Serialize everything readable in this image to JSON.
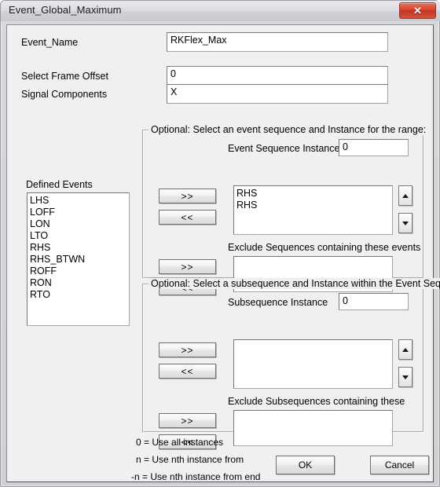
{
  "window": {
    "title": "Event_Global_Maximum",
    "close_label": "✕",
    "close_icon": "close-icon"
  },
  "form": {
    "event_name": {
      "label": "Event_Name",
      "value": "RKFlex_Max",
      "placeholder": ""
    },
    "frame_offset": {
      "label": "Select Frame Offset",
      "value": "0",
      "placeholder": ""
    },
    "signal_components": {
      "label": "Signal Components",
      "value": "X",
      "placeholder": ""
    }
  },
  "defined_events": {
    "label": "Defined Events",
    "items": [
      "LHS",
      "LOFF",
      "LON",
      "LTO",
      "RHS",
      "RHS_BTWN",
      "ROFF",
      "RON",
      "RTO"
    ]
  },
  "sequence_group": {
    "title": "Optional: Select an event sequence and Instance for the range:",
    "instance_label": "Event Sequence Instance",
    "instance_value": "0",
    "list_items": [
      "RHS",
      "RHS"
    ],
    "exclude_label": "Exclude Sequences containing these events",
    "exclude_items": [],
    "add_label": ">>",
    "remove_label": "<<",
    "exclude_add_label": ">>",
    "exclude_remove_label": "<<",
    "spin_up_icon": "arrow-up-icon",
    "spin_down_icon": "arrow-down-icon"
  },
  "subsequence_group": {
    "title": "Optional: Select a subsequence and Instance within the Event Sequence",
    "instance_label": "Subsequence Instance",
    "instance_value": "0",
    "list_items": [],
    "exclude_label": "Exclude Subsequences containing these",
    "exclude_items": [],
    "add_label": ">>",
    "remove_label": "<<",
    "exclude_add_label": ">>",
    "exclude_remove_label": "<<",
    "spin_up_icon": "arrow-up-icon",
    "spin_down_icon": "arrow-down-icon"
  },
  "help": {
    "line1": "0 = Use all instances",
    "line2": "n = Use nth instance from",
    "line3": "-n = Use nth instance from end"
  },
  "actions": {
    "ok_label": "OK",
    "cancel_label": "Cancel"
  },
  "colors": {
    "dialog_background": "#f0f0f0",
    "close_button": "#c23520",
    "field_background": "#ffffff",
    "border": "#a0a0a0"
  }
}
